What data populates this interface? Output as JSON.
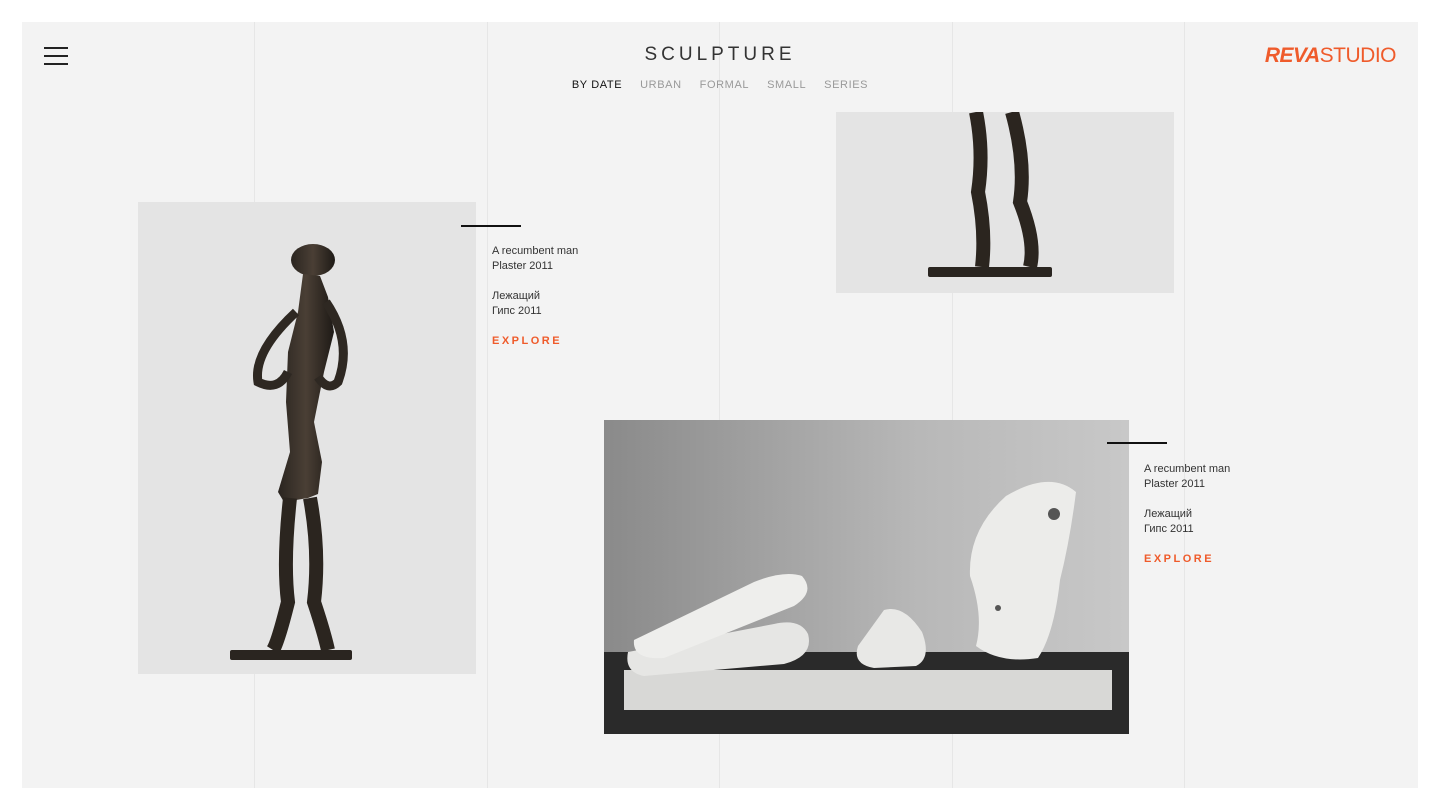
{
  "header": {
    "title": "SCULPTURE",
    "brand": {
      "part1": "REVA",
      "part2": "STUDIO"
    }
  },
  "nav": [
    {
      "label": "BY DATE",
      "active": true
    },
    {
      "label": "URBAN",
      "active": false
    },
    {
      "label": "FORMAL",
      "active": false
    },
    {
      "label": "SMALL",
      "active": false
    },
    {
      "label": "SERIES",
      "active": false
    }
  ],
  "works": [
    {
      "title_en": "A recumbent man",
      "material_en": "Plaster 2011",
      "title_ru": "Лежащий",
      "material_ru": "Гипс 2011",
      "cta": "EXPLORE"
    },
    {
      "title_en": "A recumbent man",
      "material_en": "Plaster 2011",
      "title_ru": "Лежащий",
      "material_ru": "Гипс 2011",
      "cta": "EXPLORE"
    }
  ],
  "colors": {
    "accent": "#ef5b2b",
    "background": "#f3f3f3",
    "text": "#333333"
  },
  "icons": [
    "hamburger-menu-icon"
  ]
}
